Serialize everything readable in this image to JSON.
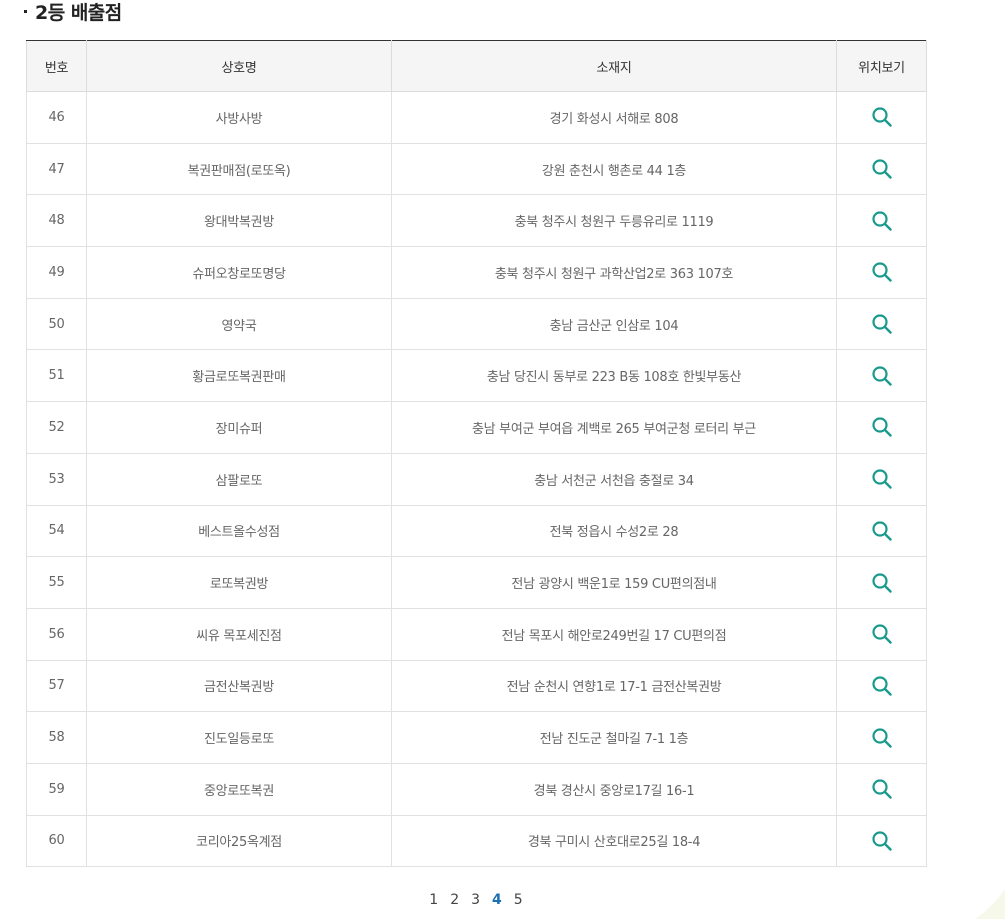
{
  "section": {
    "title": "2등 배출점"
  },
  "table": {
    "headers": [
      "번호",
      "상호명",
      "소재지",
      "위치보기"
    ],
    "rows": [
      {
        "no": "46",
        "name": "사방사방",
        "address": "경기 화성시 서해로 808"
      },
      {
        "no": "47",
        "name": "복권판매점(로또옥)",
        "address": "강원 춘천시 행촌로 44 1층"
      },
      {
        "no": "48",
        "name": "왕대박복권방",
        "address": "충북 청주시 청원구 두릉유리로 1119"
      },
      {
        "no": "49",
        "name": "슈퍼오창로또명당",
        "address": "충북 청주시 청원구 과학산업2로 363 107호"
      },
      {
        "no": "50",
        "name": "영약국",
        "address": "충남 금산군 인삼로 104"
      },
      {
        "no": "51",
        "name": "황금로또복권판매",
        "address": "충남 당진시 동부로 223 B동 108호 한빛부동산"
      },
      {
        "no": "52",
        "name": "장미슈퍼",
        "address": "충남 부여군 부여읍 계백로 265 부여군청 로터리 부근"
      },
      {
        "no": "53",
        "name": "삼팔로또",
        "address": "충남 서천군 서천읍 충절로 34"
      },
      {
        "no": "54",
        "name": "베스트올수성점",
        "address": "전북 정읍시 수성2로 28"
      },
      {
        "no": "55",
        "name": "로또복권방",
        "address": "전남 광양시 백운1로 159 CU편의점내"
      },
      {
        "no": "56",
        "name": "씨유 목포세진점",
        "address": "전남 목포시 해안로249번길 17 CU편의점"
      },
      {
        "no": "57",
        "name": "금전산복권방",
        "address": "전남 순천시 연향1로 17-1 금전산복권방"
      },
      {
        "no": "58",
        "name": "진도일등로또",
        "address": "전남 진도군 철마길 7-1 1층"
      },
      {
        "no": "59",
        "name": "중앙로또복권",
        "address": "경북 경산시 중앙로17길 16-1"
      },
      {
        "no": "60",
        "name": "코리아25옥계점",
        "address": "경북 구미시 산호대로25길 18-4"
      }
    ]
  },
  "icons": {
    "search": "search-icon"
  },
  "colors": {
    "search_icon": "#1a9a8c",
    "active_page": "#1b6fb3",
    "header_bg": "#f5f5f5",
    "header_top_border": "#333333"
  },
  "pagination": {
    "pages": [
      "1",
      "2",
      "3",
      "4",
      "5"
    ],
    "current": "4"
  }
}
